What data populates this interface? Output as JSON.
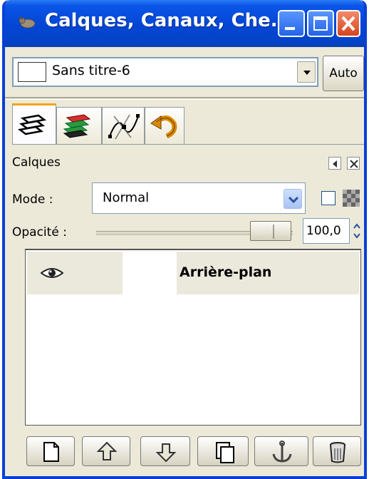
{
  "window": {
    "title": "Calques, Canaux, Che..."
  },
  "image_selector": {
    "name": "Sans titre-6",
    "auto_label": "Auto"
  },
  "tabs": [
    {
      "name": "layers",
      "icon": "layers-icon"
    },
    {
      "name": "channels",
      "icon": "channels-icon"
    },
    {
      "name": "paths",
      "icon": "paths-icon"
    },
    {
      "name": "undo",
      "icon": "undo-history-icon"
    }
  ],
  "layers_dock": {
    "label": "Calques",
    "mode_label": "Mode :",
    "mode_value": "Normal",
    "opacity_label": "Opacité :",
    "opacity_value": "100,0",
    "opacity_fraction": 1.0
  },
  "layers": [
    {
      "name": "Arrière-plan",
      "visible": true
    }
  ],
  "bottom_buttons": [
    "new-layer-icon",
    "raise-layer-icon",
    "lower-layer-icon",
    "duplicate-layer-icon",
    "anchor-layer-icon",
    "delete-layer-icon"
  ],
  "colors": {
    "titlebar": "#0447d6",
    "frame": "#ece9d8",
    "close": "#d3451c"
  }
}
